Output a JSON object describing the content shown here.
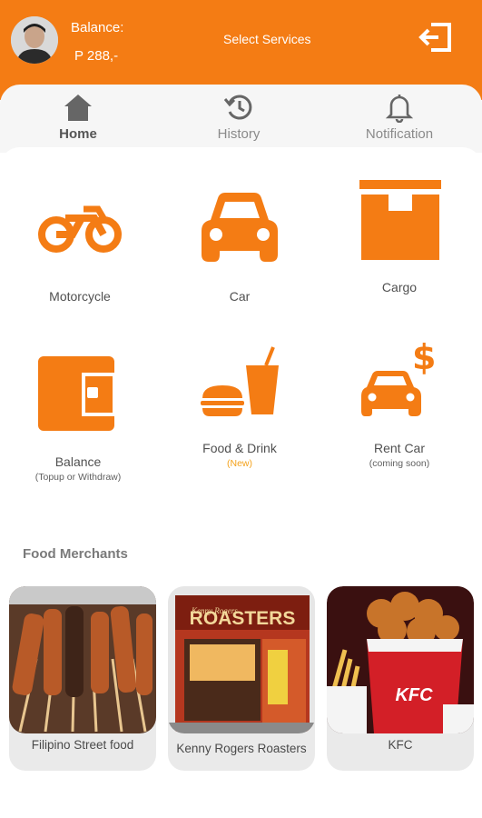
{
  "colors": {
    "accent": "#f47c14",
    "new_badge": "#f4a21c"
  },
  "header": {
    "balance_label": "Balance:",
    "balance_value": "P 288,-",
    "title": "Select Services",
    "logout_icon": "logout-icon"
  },
  "tabs": [
    {
      "label": "Home",
      "icon": "home-icon",
      "active": true
    },
    {
      "label": "History",
      "icon": "history-icon",
      "active": false
    },
    {
      "label": "Notification",
      "icon": "bell-icon",
      "active": false
    }
  ],
  "services": [
    {
      "label": "Motorcycle",
      "icon": "motorcycle-icon"
    },
    {
      "label": "Car",
      "icon": "car-icon"
    },
    {
      "label": "Cargo",
      "icon": "cargo-box-icon"
    },
    {
      "label": "Balance",
      "sublabel": "(Topup or Withdraw)",
      "icon": "wallet-icon"
    },
    {
      "label": "Food & Drink",
      "sublabel": "(New)",
      "icon": "food-drink-icon"
    },
    {
      "label": "Rent Car",
      "sublabel": "(coming soon)",
      "icon": "rent-car-icon"
    }
  ],
  "merchants_section": {
    "title": "Food Merchants",
    "items": [
      {
        "name": "Filipino Street food",
        "image": "street-food-skewers-image"
      },
      {
        "name": "Kenny Rogers Roasters",
        "image": "kenny-rogers-storefront-image",
        "sign": "ROASTERS",
        "sign_script": "Kenny Rogers"
      },
      {
        "name": "KFC",
        "image": "kfc-bucket-image",
        "logo": "KFC"
      }
    ]
  }
}
